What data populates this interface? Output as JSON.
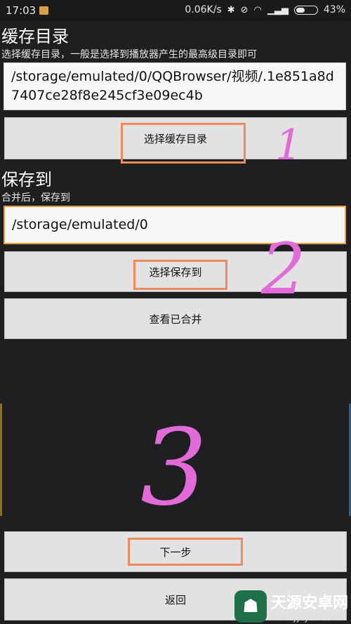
{
  "statusbar": {
    "time": "17:03",
    "speed": "0.06K/s",
    "battery": "43%",
    "battery_level": 0.43,
    "icons": [
      "bluetooth-icon",
      "mute-icon",
      "wifi-icon",
      "signal-icon",
      "battery-icon"
    ]
  },
  "cache": {
    "title": "缓存目录",
    "desc": "选择缓存目录，一般是选择到播放器产生的最高级目录即可",
    "path": "/storage/emulated/0/QQBrowser/视频/.1e851a8d7407ce28f8e245cf3e09ec4b",
    "button": "选择缓存目录"
  },
  "save": {
    "title": "保存到",
    "desc": "合并后，保存到",
    "path": "/storage/emulated/0",
    "button": "选择保存到"
  },
  "view_merged": "查看已合并",
  "next": "下一步",
  "back": "返回",
  "annotations": {
    "a1": "1",
    "a2": "2",
    "a3": "3"
  },
  "watermark": {
    "name": "天源安卓网",
    "url": "www.jytyaz.com"
  },
  "colors": {
    "highlight": "#ef8a5e",
    "focus": "#f39c36",
    "marker": "#e36ad9"
  }
}
